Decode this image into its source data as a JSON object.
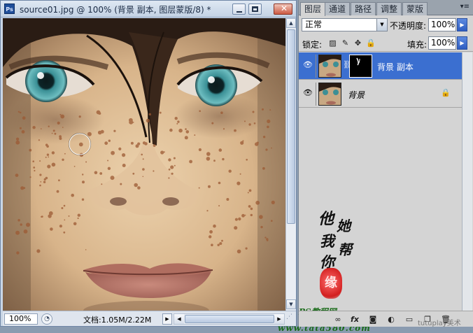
{
  "document": {
    "app_badge": "Ps",
    "title": "source01.jpg @ 100% (背景 副本, 图层蒙版/8) *",
    "zoom": "100%",
    "doc_size": "文档:1.05M/2.22M"
  },
  "layers_panel": {
    "tabs": [
      {
        "label": "图层",
        "active": true
      },
      {
        "label": "通道",
        "active": false
      },
      {
        "label": "路径",
        "active": false
      },
      {
        "label": "调整",
        "active": false
      },
      {
        "label": "蒙版",
        "active": false
      }
    ],
    "blend_mode": "正常",
    "opacity_label": "不透明度:",
    "opacity_value": "100%",
    "lock_label": "锁定:",
    "fill_label": "填充:",
    "fill_value": "100%",
    "layers": [
      {
        "name": "背景 副本",
        "visible": true,
        "selected": true,
        "has_mask": true,
        "locked": false
      },
      {
        "name": "背景",
        "visible": true,
        "selected": false,
        "has_mask": false,
        "locked": true
      }
    ]
  },
  "watermark": {
    "brush_chars": [
      "他",
      "她",
      "我",
      "帮",
      "你"
    ],
    "seal_char": "缘",
    "line1": "PS教程网",
    "line2": "www.tata580.com"
  },
  "footer_credit": "tutuplay美术",
  "colors": {
    "selected_layer": "#3b6fd0",
    "accent_arrow": "#2d5cc1"
  }
}
